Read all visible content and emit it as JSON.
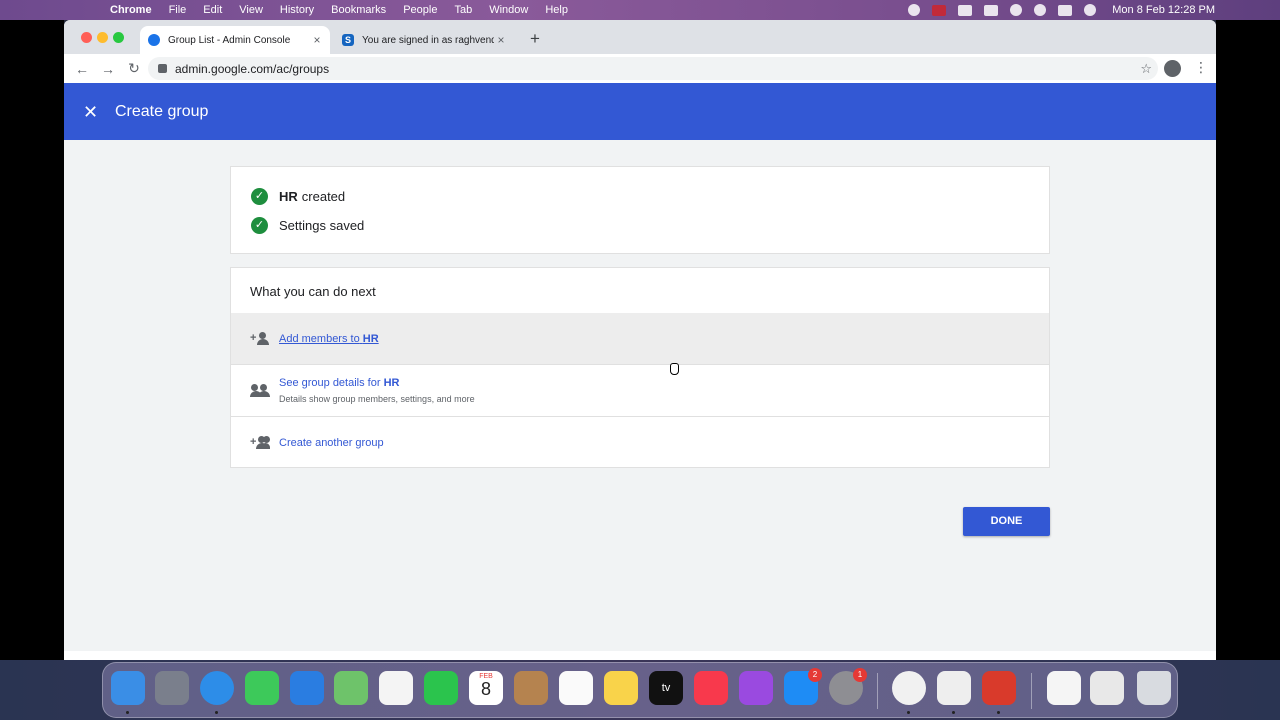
{
  "menubar": {
    "app": "Chrome",
    "items": [
      "File",
      "Edit",
      "View",
      "History",
      "Bookmarks",
      "People",
      "Tab",
      "Window",
      "Help"
    ],
    "clock": "Mon 8 Feb  12:28 PM"
  },
  "browser": {
    "tabs": [
      {
        "title": "Group List - Admin Console"
      },
      {
        "title": "You are signed in as raghvendra"
      }
    ],
    "url": "admin.google.com/ac/groups"
  },
  "appbar": {
    "title": "Create group"
  },
  "status": {
    "group_name": "HR",
    "created_text": "created",
    "settings_text": "Settings saved"
  },
  "next": {
    "title": "What you can do next",
    "add_members_prefix": "Add members to",
    "group_name": "HR",
    "details_prefix": "See group details for",
    "details_sub": "Details show group members, settings, and more",
    "create_another": "Create another group"
  },
  "done_label": "DONE",
  "dock": {
    "calendar_month": "FEB",
    "calendar_day": "8",
    "appstore_badge": "2",
    "settings_badge": "1",
    "tv_label": "tv"
  },
  "colors": {
    "primary": "#3358d4",
    "success": "#1e8e3e"
  }
}
